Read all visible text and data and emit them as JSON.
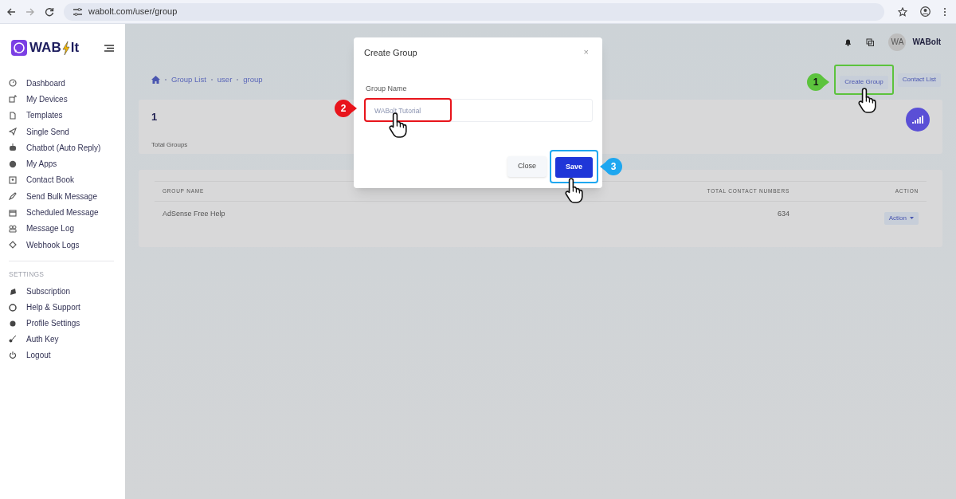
{
  "browser": {
    "url": "wabolt.com/user/group"
  },
  "sidebar": {
    "logo": {
      "part_1": "WAB",
      "part_2": "lt"
    },
    "items": [
      {
        "label": "Dashboard"
      },
      {
        "label": "My Devices"
      },
      {
        "label": "Templates"
      },
      {
        "label": "Single Send"
      },
      {
        "label": "Chatbot (Auto Reply)"
      },
      {
        "label": "My Apps"
      },
      {
        "label": "Contact Book"
      },
      {
        "label": "Send Bulk Message"
      },
      {
        "label": "Scheduled Message"
      },
      {
        "label": "Message Log"
      },
      {
        "label": "Webhook Logs"
      }
    ],
    "settings_heading": "SETTINGS",
    "settings_items": [
      {
        "label": "Subscription"
      },
      {
        "label": "Help & Support"
      },
      {
        "label": "Profile Settings"
      },
      {
        "label": "Auth Key"
      },
      {
        "label": "Logout"
      }
    ]
  },
  "header": {
    "avatar_initials": "WA",
    "user_name": "WABolt"
  },
  "breadcrumb": [
    "Group List",
    "user",
    "group"
  ],
  "page_buttons": [
    "Create Group",
    "Contact List"
  ],
  "stats": {
    "value": "1",
    "label": "Total Groups"
  },
  "table": {
    "columns": [
      "GROUP NAME",
      "TOTAL CONTACT NUMBERS",
      "ACTION"
    ],
    "rows": [
      {
        "group_name": "AdSense Free Help",
        "total": "634",
        "action": "Action"
      }
    ]
  },
  "modal": {
    "title": "Create Group",
    "close_glyph": "×",
    "field_label": "Group Name",
    "field_value": "WABolt Tutorial",
    "close_button": "Close",
    "save_button": "Save"
  },
  "annotations": [
    {
      "number": "1",
      "color": "#5cc33d"
    },
    {
      "number": "2",
      "color": "#e8141b"
    },
    {
      "number": "3",
      "color": "#1ea7f0"
    }
  ]
}
